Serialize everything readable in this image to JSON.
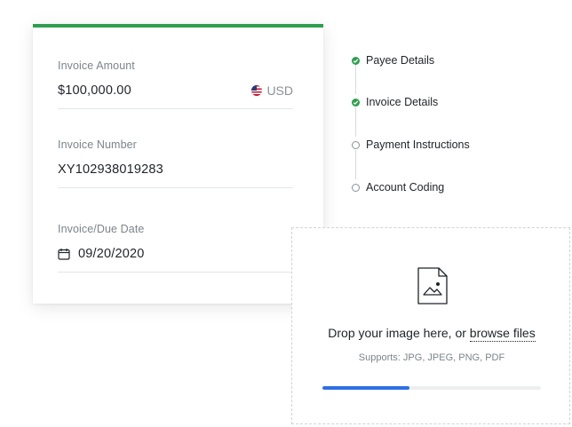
{
  "invoice": {
    "amount_label": "Invoice Amount",
    "amount_value": "$100,000.00",
    "currency": "USD",
    "number_label": "Invoice Number",
    "number_value": "XY102938019283",
    "date_label": "Invoice/Due Date",
    "date_value": "09/20/2020"
  },
  "steps": [
    {
      "label": "Payee Details",
      "status": "complete"
    },
    {
      "label": "Invoice Details",
      "status": "complete"
    },
    {
      "label": "Payment Instructions",
      "status": "pending"
    },
    {
      "label": "Account Coding",
      "status": "pending"
    }
  ],
  "upload": {
    "prompt": "Drop your image here, or",
    "browse_label": "browse files",
    "supports": "Supports: JPG, JPEG, PNG, PDF",
    "progress": 0.4
  },
  "colors": {
    "accent_green": "#2f9e4f",
    "progress_blue": "#2e6fe6"
  },
  "icons": {
    "currency_flag": "us-flag-icon",
    "date": "calendar-icon",
    "step_complete": "check-circle-icon",
    "step_pending": "empty-circle-icon",
    "file": "image-file-icon"
  }
}
